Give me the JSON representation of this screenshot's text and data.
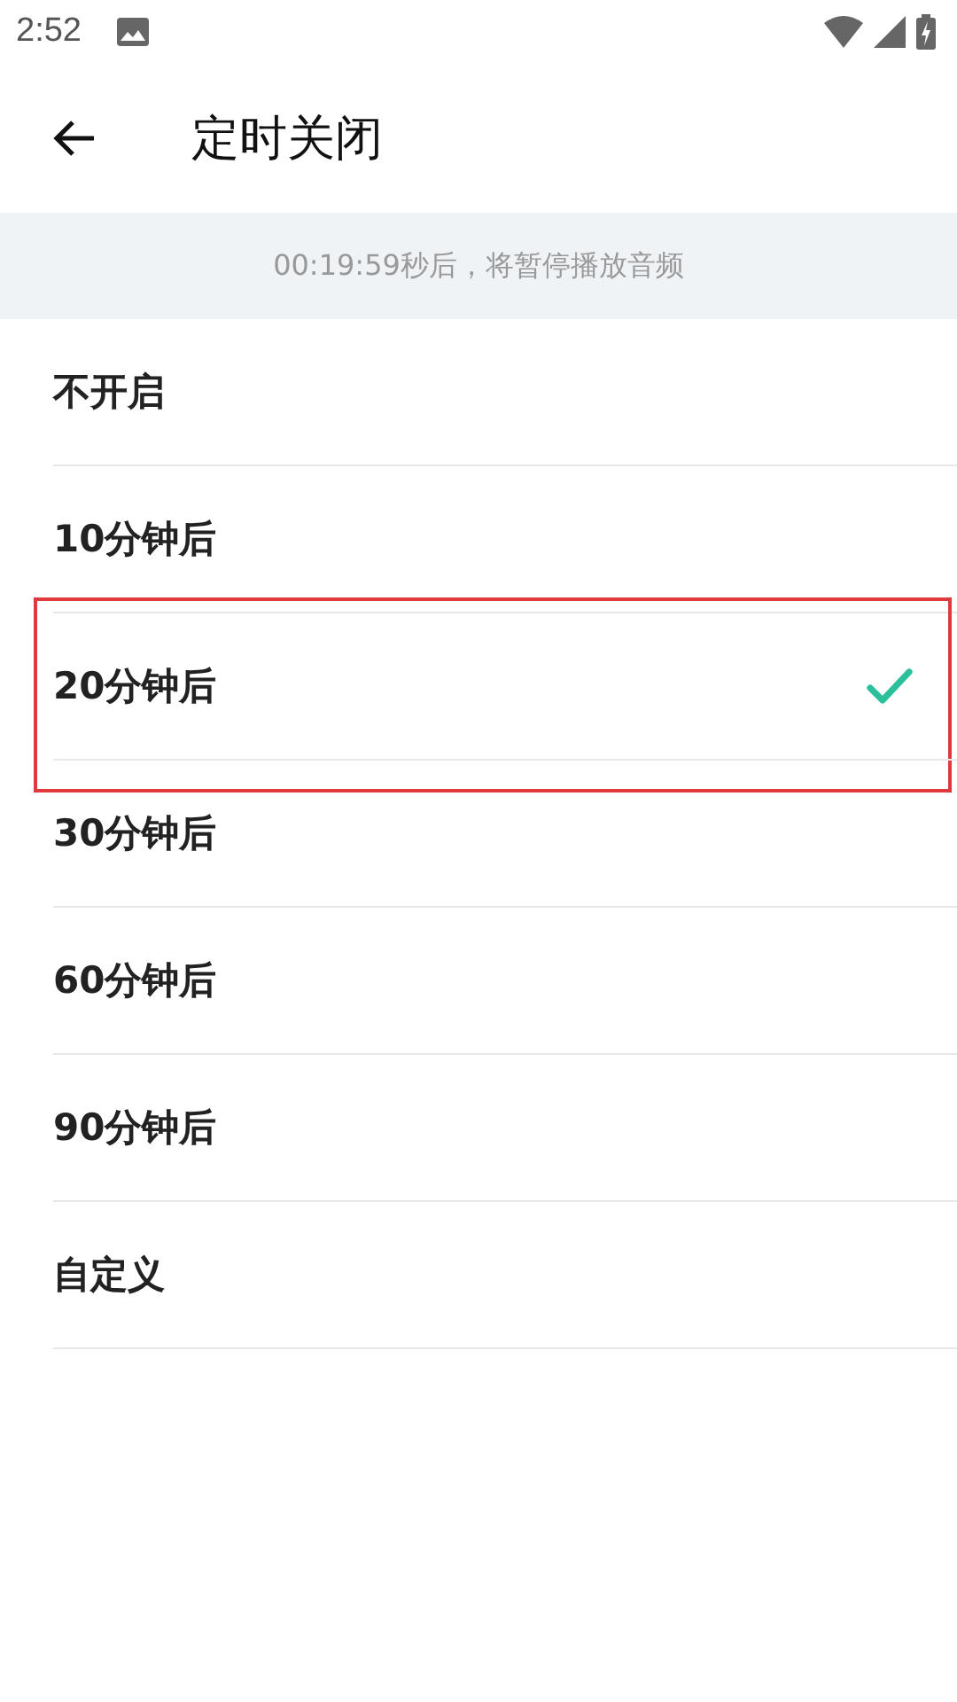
{
  "status_bar": {
    "time": "2:52"
  },
  "header": {
    "title": "定时关闭"
  },
  "notice": "00:19:59秒后，将暂停播放音频",
  "options": [
    {
      "label": "不开启",
      "selected": false,
      "highlighted": false
    },
    {
      "label": "10分钟后",
      "selected": false,
      "highlighted": false
    },
    {
      "label": "20分钟后",
      "selected": true,
      "highlighted": true
    },
    {
      "label": "30分钟后",
      "selected": false,
      "highlighted": false
    },
    {
      "label": "60分钟后",
      "selected": false,
      "highlighted": false
    },
    {
      "label": "90分钟后",
      "selected": false,
      "highlighted": false
    },
    {
      "label": "自定义",
      "selected": false,
      "highlighted": false
    }
  ]
}
